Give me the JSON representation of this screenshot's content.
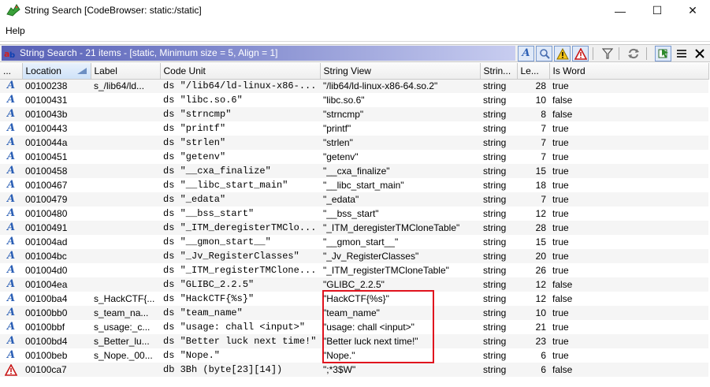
{
  "window": {
    "title": "String Search [CodeBrowser: static:/static]",
    "menu": [
      "Help"
    ],
    "controls": {
      "minimize": "—",
      "maximize": "☐",
      "close": "✕"
    }
  },
  "panel": {
    "title": "String Search - 21 items - [static, Minimum size = 5, Align = 1]",
    "toolbar_icons": [
      "defined-string-icon",
      "undefined-string-icon",
      "partially-defined-warning-icon",
      "conflicting-warning-icon",
      "filter-icon",
      "refresh-icon",
      "make-selection-icon",
      "table-view-icon",
      "close-panel-icon"
    ]
  },
  "columns": [
    "...",
    "Location",
    "Label",
    "Code Unit",
    "String View",
    "Strin...",
    "Le...",
    "Is Word"
  ],
  "rows": [
    {
      "icon": "defined-string-icon",
      "location": "00100238",
      "label": "s_/lib64/ld...",
      "code_unit": "ds \"/lib64/ld-linux-x86-...",
      "string_view": "\"/lib64/ld-linux-x86-64.so.2\"",
      "type": "string",
      "len": "28",
      "is_word": "true"
    },
    {
      "icon": "defined-string-icon",
      "location": "00100431",
      "label": "",
      "code_unit": "ds \"libc.so.6\"",
      "string_view": "\"libc.so.6\"",
      "type": "string",
      "len": "10",
      "is_word": "false"
    },
    {
      "icon": "defined-string-icon",
      "location": "0010043b",
      "label": "",
      "code_unit": "ds \"strncmp\"",
      "string_view": "\"strncmp\"",
      "type": "string",
      "len": "8",
      "is_word": "false"
    },
    {
      "icon": "defined-string-icon",
      "location": "00100443",
      "label": "",
      "code_unit": "ds \"printf\"",
      "string_view": "\"printf\"",
      "type": "string",
      "len": "7",
      "is_word": "true"
    },
    {
      "icon": "defined-string-icon",
      "location": "0010044a",
      "label": "",
      "code_unit": "ds \"strlen\"",
      "string_view": "\"strlen\"",
      "type": "string",
      "len": "7",
      "is_word": "true"
    },
    {
      "icon": "defined-string-icon",
      "location": "00100451",
      "label": "",
      "code_unit": "ds \"getenv\"",
      "string_view": "\"getenv\"",
      "type": "string",
      "len": "7",
      "is_word": "true"
    },
    {
      "icon": "defined-string-icon",
      "location": "00100458",
      "label": "",
      "code_unit": "ds \"__cxa_finalize\"",
      "string_view": "\"__cxa_finalize\"",
      "type": "string",
      "len": "15",
      "is_word": "true"
    },
    {
      "icon": "defined-string-icon",
      "location": "00100467",
      "label": "",
      "code_unit": "ds \"__libc_start_main\"",
      "string_view": "\"__libc_start_main\"",
      "type": "string",
      "len": "18",
      "is_word": "true"
    },
    {
      "icon": "defined-string-icon",
      "location": "00100479",
      "label": "",
      "code_unit": "ds \"_edata\"",
      "string_view": "\"_edata\"",
      "type": "string",
      "len": "7",
      "is_word": "true"
    },
    {
      "icon": "defined-string-icon",
      "location": "00100480",
      "label": "",
      "code_unit": "ds \"__bss_start\"",
      "string_view": "\"__bss_start\"",
      "type": "string",
      "len": "12",
      "is_word": "true"
    },
    {
      "icon": "defined-string-icon",
      "location": "00100491",
      "label": "",
      "code_unit": "ds \"_ITM_deregisterTMClo...",
      "string_view": "\"_ITM_deregisterTMCloneTable\"",
      "type": "string",
      "len": "28",
      "is_word": "true"
    },
    {
      "icon": "defined-string-icon",
      "location": "001004ad",
      "label": "",
      "code_unit": "ds \"__gmon_start__\"",
      "string_view": "\"__gmon_start__\"",
      "type": "string",
      "len": "15",
      "is_word": "true"
    },
    {
      "icon": "defined-string-icon",
      "location": "001004bc",
      "label": "",
      "code_unit": "ds \"_Jv_RegisterClasses\"",
      "string_view": "\"_Jv_RegisterClasses\"",
      "type": "string",
      "len": "20",
      "is_word": "true"
    },
    {
      "icon": "defined-string-icon",
      "location": "001004d0",
      "label": "",
      "code_unit": "ds \"_ITM_registerTMClone...",
      "string_view": "\"_ITM_registerTMCloneTable\"",
      "type": "string",
      "len": "26",
      "is_word": "true"
    },
    {
      "icon": "defined-string-icon",
      "location": "001004ea",
      "label": "",
      "code_unit": "ds \"GLIBC_2.2.5\"",
      "string_view": "\"GLIBC_2.2.5\"",
      "type": "string",
      "len": "12",
      "is_word": "false"
    },
    {
      "icon": "defined-string-icon",
      "location": "00100ba4",
      "label": "s_HackCTF{...",
      "code_unit": "ds \"HackCTF{%s}\"",
      "string_view": "\"HackCTF{%s}\"",
      "type": "string",
      "len": "12",
      "is_word": "false"
    },
    {
      "icon": "defined-string-icon",
      "location": "00100bb0",
      "label": "s_team_na...",
      "code_unit": "ds \"team_name\"",
      "string_view": "\"team_name\"",
      "type": "string",
      "len": "10",
      "is_word": "true"
    },
    {
      "icon": "defined-string-icon",
      "location": "00100bbf",
      "label": "s_usage:_c...",
      "code_unit": "ds \"usage: chall <input>\"",
      "string_view": "\"usage: chall <input>\"",
      "type": "string",
      "len": "21",
      "is_word": "true"
    },
    {
      "icon": "defined-string-icon",
      "location": "00100bd4",
      "label": "s_Better_lu...",
      "code_unit": "ds \"Better luck next time!\"",
      "string_view": "\"Better luck next time!\"",
      "type": "string",
      "len": "23",
      "is_word": "true"
    },
    {
      "icon": "defined-string-icon",
      "location": "00100beb",
      "label": "s_Nope._00...",
      "code_unit": "ds \"Nope.\"",
      "string_view": "\"Nope.\"",
      "type": "string",
      "len": "6",
      "is_word": "true"
    },
    {
      "icon": "warning-string-icon",
      "location": "00100ca7",
      "label": "",
      "code_unit": "db 3Bh (byte[23][14])",
      "string_view": "\";*3$W\"",
      "type": "string",
      "len": "6",
      "is_word": "false"
    }
  ],
  "colors": {
    "panel_title_start": "#5760b6",
    "highlight": "#e0141e",
    "icon_blue": "#2b5fb5"
  }
}
